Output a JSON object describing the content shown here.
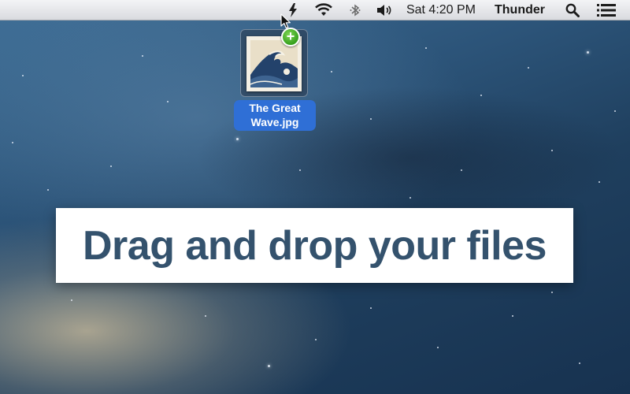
{
  "menubar": {
    "icons": [
      "bolt-icon",
      "wifi-icon",
      "bluetooth-icon",
      "volume-icon",
      "search-icon",
      "list-icon"
    ],
    "clock": "Sat 4:20 PM",
    "user": "Thunder"
  },
  "dragged_file": {
    "name_line1": "The Great",
    "name_line2": "Wave.jpg",
    "badge": "+",
    "badge_color": "#3aa51f",
    "label_color": "#2f6fd6"
  },
  "banner": {
    "text": "Drag and drop your files",
    "text_color": "#34526d"
  }
}
